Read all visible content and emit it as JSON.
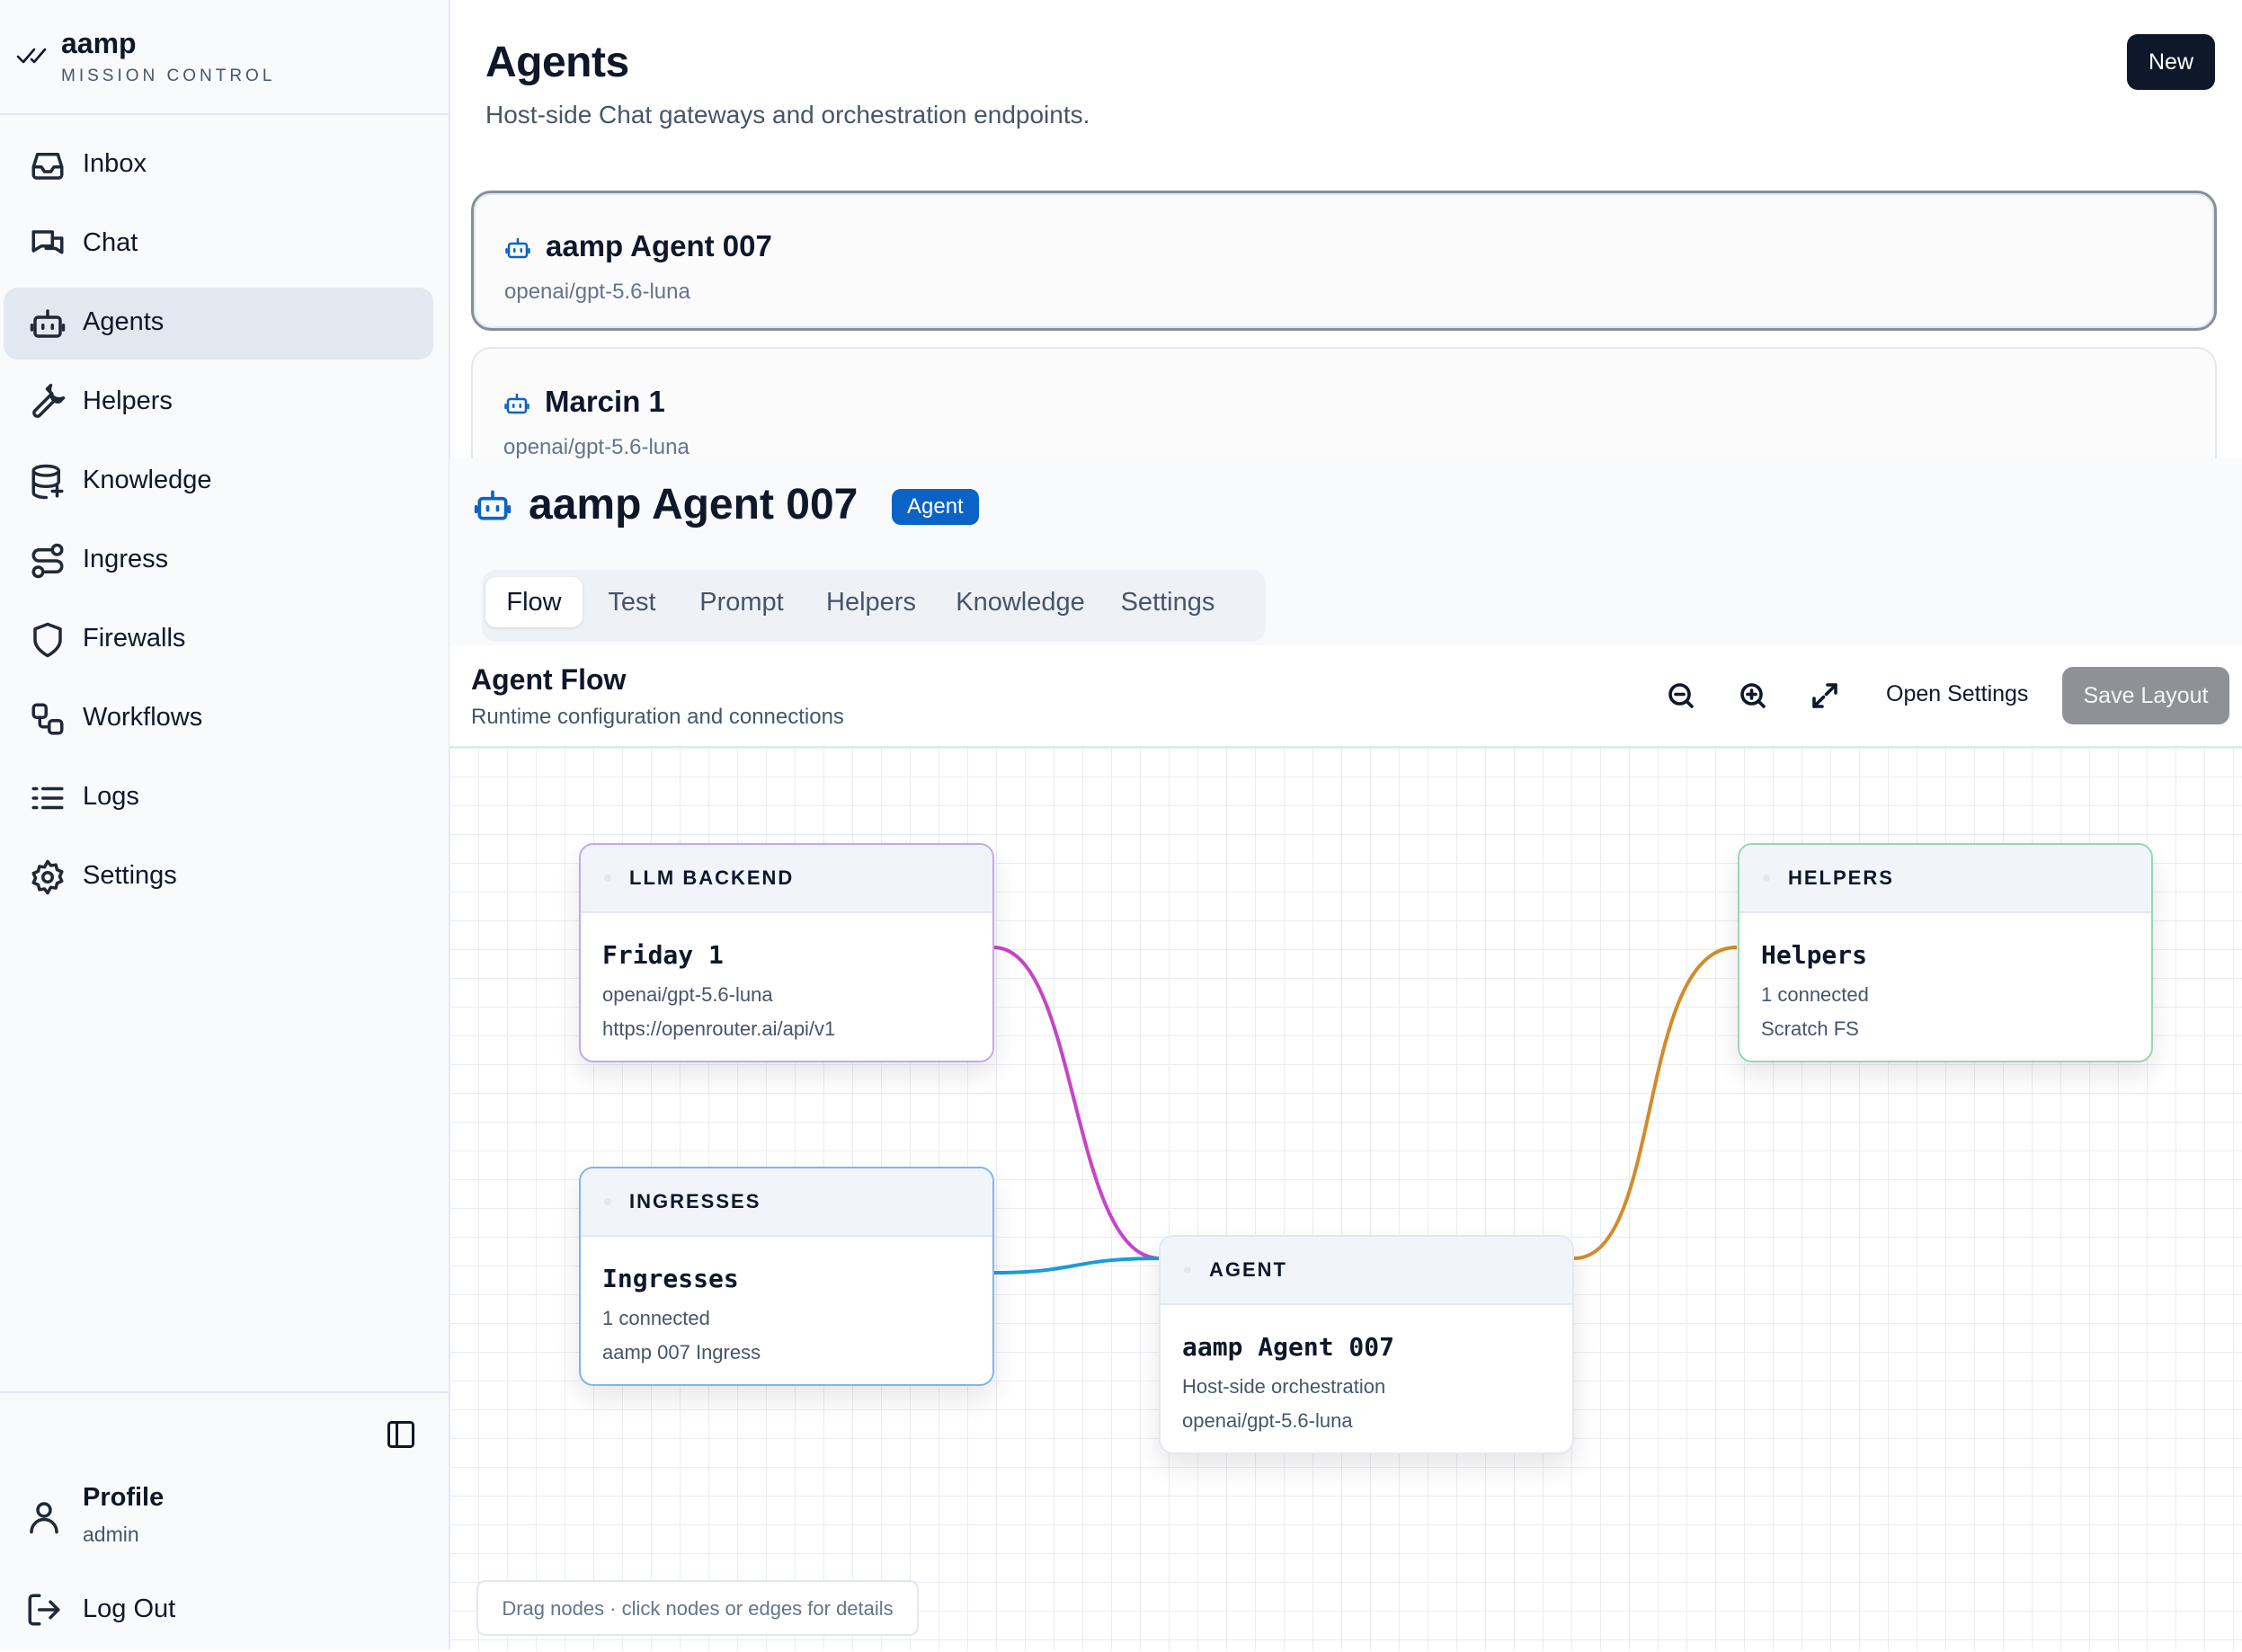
{
  "brand": {
    "name": "aamp",
    "subtitle": "MISSION CONTROL"
  },
  "sidebar": {
    "items": [
      {
        "label": "Inbox",
        "icon": "inbox-icon"
      },
      {
        "label": "Chat",
        "icon": "chat-icon"
      },
      {
        "label": "Agents",
        "icon": "robot-icon",
        "active": true
      },
      {
        "label": "Helpers",
        "icon": "wrench-icon"
      },
      {
        "label": "Knowledge",
        "icon": "database-icon"
      },
      {
        "label": "Ingress",
        "icon": "route-icon"
      },
      {
        "label": "Firewalls",
        "icon": "shield-icon"
      },
      {
        "label": "Workflows",
        "icon": "workflow-icon"
      },
      {
        "label": "Logs",
        "icon": "list-icon"
      },
      {
        "label": "Settings",
        "icon": "gear-icon"
      }
    ],
    "profile": {
      "name": "Profile",
      "role": "admin"
    },
    "logout_label": "Log Out"
  },
  "header": {
    "title": "Agents",
    "subtitle": "Host-side Chat gateways and orchestration endpoints.",
    "new_label": "New"
  },
  "agents": [
    {
      "name": "aamp Agent 007",
      "model": "openai/gpt-5.6-luna",
      "selected": true
    },
    {
      "name": "Marcin 1",
      "model": "openai/gpt-5.6-luna"
    }
  ],
  "detail": {
    "title": "aamp Agent 007",
    "badge": "Agent",
    "tabs": [
      "Flow",
      "Test",
      "Prompt",
      "Helpers",
      "Knowledge",
      "Settings"
    ],
    "active_tab": "Flow"
  },
  "flow": {
    "title": "Agent Flow",
    "subtitle": "Runtime configuration and connections",
    "open_settings_label": "Open Settings",
    "save_layout_label": "Save Layout",
    "hint": "Drag nodes · click nodes or edges for details",
    "nodes": {
      "llm": {
        "kind": "LLM BACKEND",
        "title": "Friday 1",
        "line1": "openai/gpt-5.6-luna",
        "line2": "https://openrouter.ai/api/v1",
        "color": "#c084fc"
      },
      "ingresses": {
        "kind": "INGRESSES",
        "title": "Ingresses",
        "line1": "1 connected",
        "line2": "aamp 007 Ingress",
        "color": "#60a5fa"
      },
      "agent": {
        "kind": "AGENT",
        "title": "aamp Agent 007",
        "line1": "Host-side orchestration",
        "line2": "openai/gpt-5.6-luna",
        "color": "#e2e8f0"
      },
      "helpers": {
        "kind": "HELPERS",
        "title": "Helpers",
        "line1": "1 connected",
        "line2": "Scratch FS",
        "color": "#86d0a4"
      }
    },
    "edge_colors": {
      "llm": "#c545c7",
      "ingress": "#1d9bd8",
      "helpers": "#d38b2a"
    }
  }
}
